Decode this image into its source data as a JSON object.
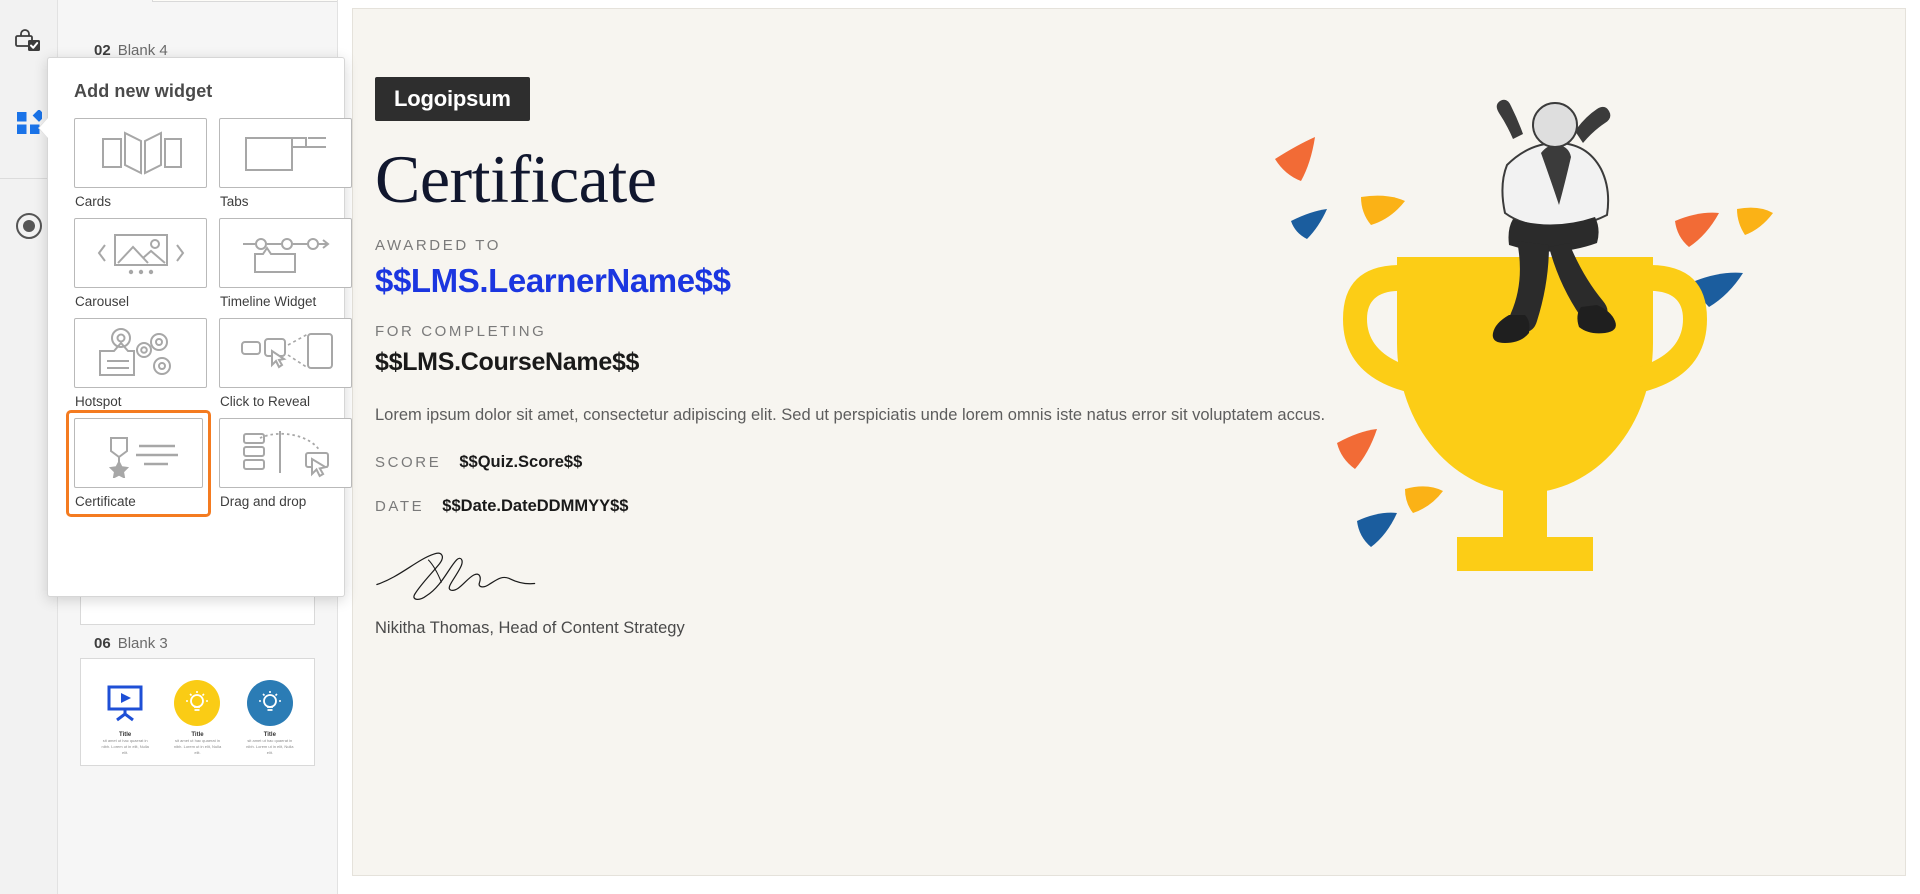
{
  "rail": {
    "items": [
      {
        "name": "interactions-lock-icon",
        "label": "Interactions"
      },
      {
        "name": "widgets-icon",
        "label": "Widgets",
        "active": true,
        "color": "#1a73e8"
      },
      {
        "name": "record-icon",
        "label": "Record"
      }
    ]
  },
  "slides": {
    "items": [
      {
        "num": "02",
        "title": "Blank 4"
      },
      {
        "num": "06",
        "title": "Blank 3"
      }
    ],
    "card_thumb": {
      "title": "Title",
      "body": "sit amet ut hac quaerat in nibh. Lorem ut in elit, Nulla elit."
    }
  },
  "popover": {
    "title": "Add new widget",
    "widgets": [
      {
        "label": "Cards",
        "icon": "cards-icon",
        "selected": false
      },
      {
        "label": "Tabs",
        "icon": "tabs-icon",
        "selected": false
      },
      {
        "label": "Carousel",
        "icon": "carousel-icon",
        "selected": false
      },
      {
        "label": "Timeline Widget",
        "icon": "timeline-icon",
        "selected": false
      },
      {
        "label": "Hotspot",
        "icon": "hotspot-icon",
        "selected": false
      },
      {
        "label": "Click to Reveal",
        "icon": "click-to-reveal-icon",
        "selected": false
      },
      {
        "label": "Certificate",
        "icon": "certificate-icon",
        "selected": true
      },
      {
        "label": "Drag and drop",
        "icon": "drag-and-drop-icon",
        "selected": false
      }
    ],
    "selection_color": "#f47b20"
  },
  "certificate": {
    "logo": "Logoipsum",
    "heading": "Certificate",
    "awarded_to_label": "AWARDED TO",
    "learner_name": "$$LMS.LearnerName$$",
    "for_completing_label": "FOR COMPLETING",
    "course_name": "$$LMS.CourseName$$",
    "description": "Lorem ipsum dolor sit amet, consectetur adipiscing elit. Sed ut perspiciatis unde lorem omnis iste natus error sit voluptatem accus.",
    "score_label": "SCORE",
    "score_value": "$$Quiz.Score$$",
    "date_label": "DATE",
    "date_value": "$$Date.DateDDMMYY$$",
    "signee": "Nikitha Thomas, Head of Content Strategy",
    "learner_color": "#1b36e0",
    "background": "#f7f5f0",
    "logo_background": "#2e2e2e",
    "trophy_color": "#fccd16",
    "confetti_colors": [
      "#f26b36",
      "#fbb216",
      "#1b5d9e"
    ]
  }
}
